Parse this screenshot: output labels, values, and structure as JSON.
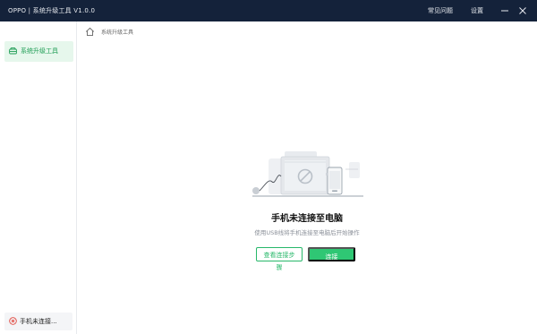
{
  "app": {
    "title": "OPPO | 系统升级工具  V1.0.0"
  },
  "titlebar": {
    "help_label": "常见问题",
    "settings_label": "设置",
    "minimize_icon": "minus-icon",
    "close_icon": "close-icon"
  },
  "sidebar": {
    "items": [
      {
        "label": "系统升级工具",
        "icon": "disk-icon",
        "active": true
      }
    ],
    "status": {
      "text": "手机未连接...",
      "icon": "error-circle-icon",
      "color": "#e0463d"
    }
  },
  "breadcrumb": {
    "home_icon": "home-icon",
    "current": "系统升级工具"
  },
  "main": {
    "headline": "手机未连接至电脑",
    "subtext": "使用USB线将手机连接至电脑后开始操作",
    "view_steps_label": "查看连接步骤",
    "connect_label": "连接"
  },
  "colors": {
    "titlebar_bg": "#14223a",
    "accent": "#2fc774",
    "sidebar_active_bg": "#e6f7ec",
    "error": "#e0463d"
  }
}
